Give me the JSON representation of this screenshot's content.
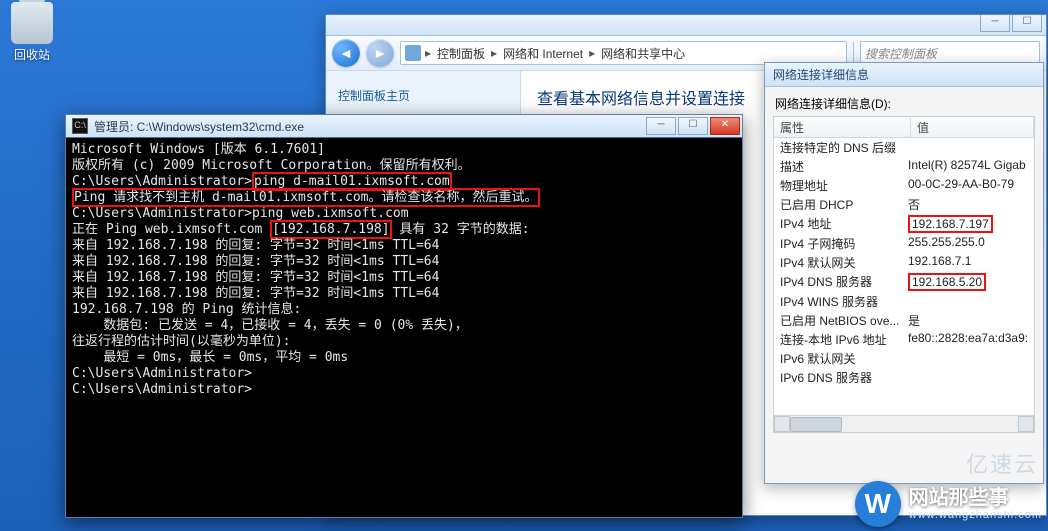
{
  "desktop": {
    "recycle_bin": "回收站"
  },
  "netcenter": {
    "breadcrumb": {
      "seg1": "控制面板",
      "seg2": "网络和 Internet",
      "seg3": "网络和共享中心"
    },
    "search_placeholder": "搜索控制面板",
    "left_link": "控制面板主页",
    "main_title": "查看基本网络信息并设置连接"
  },
  "details": {
    "window_title": "网络连接详细信息",
    "label": "网络连接详细信息(D):",
    "cols": {
      "prop": "属性",
      "val": "值"
    },
    "rows": [
      {
        "p": "连接特定的 DNS 后缀",
        "v": ""
      },
      {
        "p": "描述",
        "v": "Intel(R) 82574L Gigab"
      },
      {
        "p": "物理地址",
        "v": "00-0C-29-AA-B0-79"
      },
      {
        "p": "已启用 DHCP",
        "v": "否"
      },
      {
        "p": "IPv4 地址",
        "v": "192.168.7.197",
        "boxed": true
      },
      {
        "p": "IPv4 子网掩码",
        "v": "255.255.255.0"
      },
      {
        "p": "IPv4 默认网关",
        "v": "192.168.7.1"
      },
      {
        "p": "IPv4 DNS 服务器",
        "v": "192.168.5.20",
        "boxed": true
      },
      {
        "p": "IPv4 WINS 服务器",
        "v": ""
      },
      {
        "p": "已启用 NetBIOS ove...",
        "v": "是"
      },
      {
        "p": "连接-本地 IPv6 地址",
        "v": "fe80::2828:ea7a:d3a9:"
      },
      {
        "p": "IPv6 默认网关",
        "v": ""
      },
      {
        "p": "IPv6 DNS 服务器",
        "v": ""
      }
    ]
  },
  "cmd": {
    "title": "管理员: C:\\Windows\\system32\\cmd.exe",
    "lines": {
      "l1": "Microsoft Windows [版本 6.1.7601]",
      "l2": "版权所有 (c) 2009 Microsoft Corporation。保留所有权利。",
      "l3": "",
      "p1a": "C:\\Users\\Administrator>",
      "p1b": "ping d-mail01.ixmsoft.com",
      "l5a": "Ping 请求找不到主机 d-mail01.ixmsoft.com。请检查该名称，然后重试。",
      "l6": "",
      "l7": "C:\\Users\\Administrator>ping web.ixmsoft.com",
      "l8": "",
      "l9a": "正在 Ping web.ixmsoft.com ",
      "l9b": "[192.168.7.198]",
      "l9c": " 具有 32 字节的数据:",
      "l10": "来自 192.168.7.198 的回复: 字节=32 时间<1ms TTL=64",
      "l11": "来自 192.168.7.198 的回复: 字节=32 时间<1ms TTL=64",
      "l12": "来自 192.168.7.198 的回复: 字节=32 时间<1ms TTL=64",
      "l13": "来自 192.168.7.198 的回复: 字节=32 时间<1ms TTL=64",
      "l14": "",
      "l15": "192.168.7.198 的 Ping 统计信息:",
      "l16": "    数据包: 已发送 = 4，已接收 = 4，丢失 = 0 (0% 丢失)，",
      "l17": "往返行程的估计时间(以毫秒为单位):",
      "l18": "    最短 = 0ms，最长 = 0ms，平均 = 0ms",
      "l19": "",
      "l20": "C:\\Users\\Administrator>",
      "l21": "",
      "l22": "C:\\Users\\Administrator>"
    }
  },
  "watermark": {
    "badge": "W",
    "title": "网站那些事",
    "url": "www.wangzhanshi.com",
    "yiyun": "亿速云"
  }
}
